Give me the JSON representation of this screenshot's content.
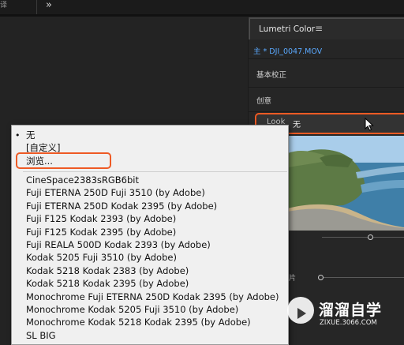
{
  "topbar": {
    "tab_fragment": "译",
    "overflow_chevron": "»"
  },
  "lumetri": {
    "title": "Lumetri Color",
    "menu_icon": "≡",
    "clip": "主 * DJI_0047.MOV",
    "section_basic": "基本校正",
    "section_creative": "创意",
    "look_label": "Look",
    "look_value": "无",
    "side_label": "片"
  },
  "menu": {
    "bullet": "•",
    "items": [
      "无",
      "[自定义]",
      "浏览...",
      "CineSpace2383sRGB6bit",
      "Fuji ETERNA 250D Fuji 3510 (by Adobe)",
      "Fuji ETERNA 250D Kodak 2395 (by Adobe)",
      "Fuji F125 Kodak 2393 (by Adobe)",
      "Fuji F125 Kodak 2395 (by Adobe)",
      "Fuji REALA 500D Kodak 2393 (by Adobe)",
      "Kodak 5205 Fuji 3510 (by Adobe)",
      "Kodak 5218 Kodak 2383 (by Adobe)",
      "Kodak 5218 Kodak 2395 (by Adobe)",
      "Monochrome Fuji ETERNA 250D Kodak 2395 (by Adobe)",
      "Monochrome Kodak 5205 Fuji 3510 (by Adobe)",
      "Monochrome Kodak 5218 Kodak 2395 (by Adobe)",
      "SL BIG"
    ]
  },
  "watermark": {
    "name": "溜溜自学",
    "url": "ZIXUE.3066.COM"
  },
  "colors": {
    "accent_outline": "#ee5a24",
    "clip_link": "#5aa9ff",
    "panel_bg": "#262626",
    "menu_bg": "#f0f0f0"
  }
}
